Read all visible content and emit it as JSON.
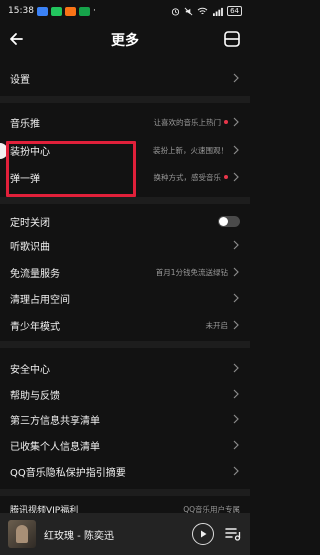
{
  "status_bar": {
    "time": "15:38",
    "battery": "64"
  },
  "header": {
    "title": "更多"
  },
  "rows": {
    "settings": "设置",
    "music_push": {
      "label": "音乐推",
      "sub": "让喜欢的音乐上热门"
    },
    "dress_center": {
      "label": "装扮中心",
      "sub": "装扮上新，火速围观！"
    },
    "tantan": {
      "label": "弹一弹",
      "sub": "换种方式，感受音乐"
    },
    "timer": "定时关闭",
    "recognize": "听歌识曲",
    "free_flow": {
      "label": "免流量服务",
      "sub": "首月1分钱免流送绿钻"
    },
    "clean": "清理占用空间",
    "teen_mode": {
      "label": "青少年模式",
      "sub": "未开启"
    },
    "security": "安全中心",
    "help": "帮助与反馈",
    "third_party": "第三方信息共享清单",
    "personal_info": "已收集个人信息清单",
    "privacy": "QQ音乐隐私保护指引摘要",
    "vip_benefit": {
      "label": "腾讯视频VIP福利",
      "sub": "QQ音乐用户专属"
    }
  },
  "player": {
    "song": "红玫瑰 - 陈奕迅"
  },
  "colors": {
    "background": "#121212",
    "highlight": "#e1203a",
    "dot": "#e8364a"
  }
}
